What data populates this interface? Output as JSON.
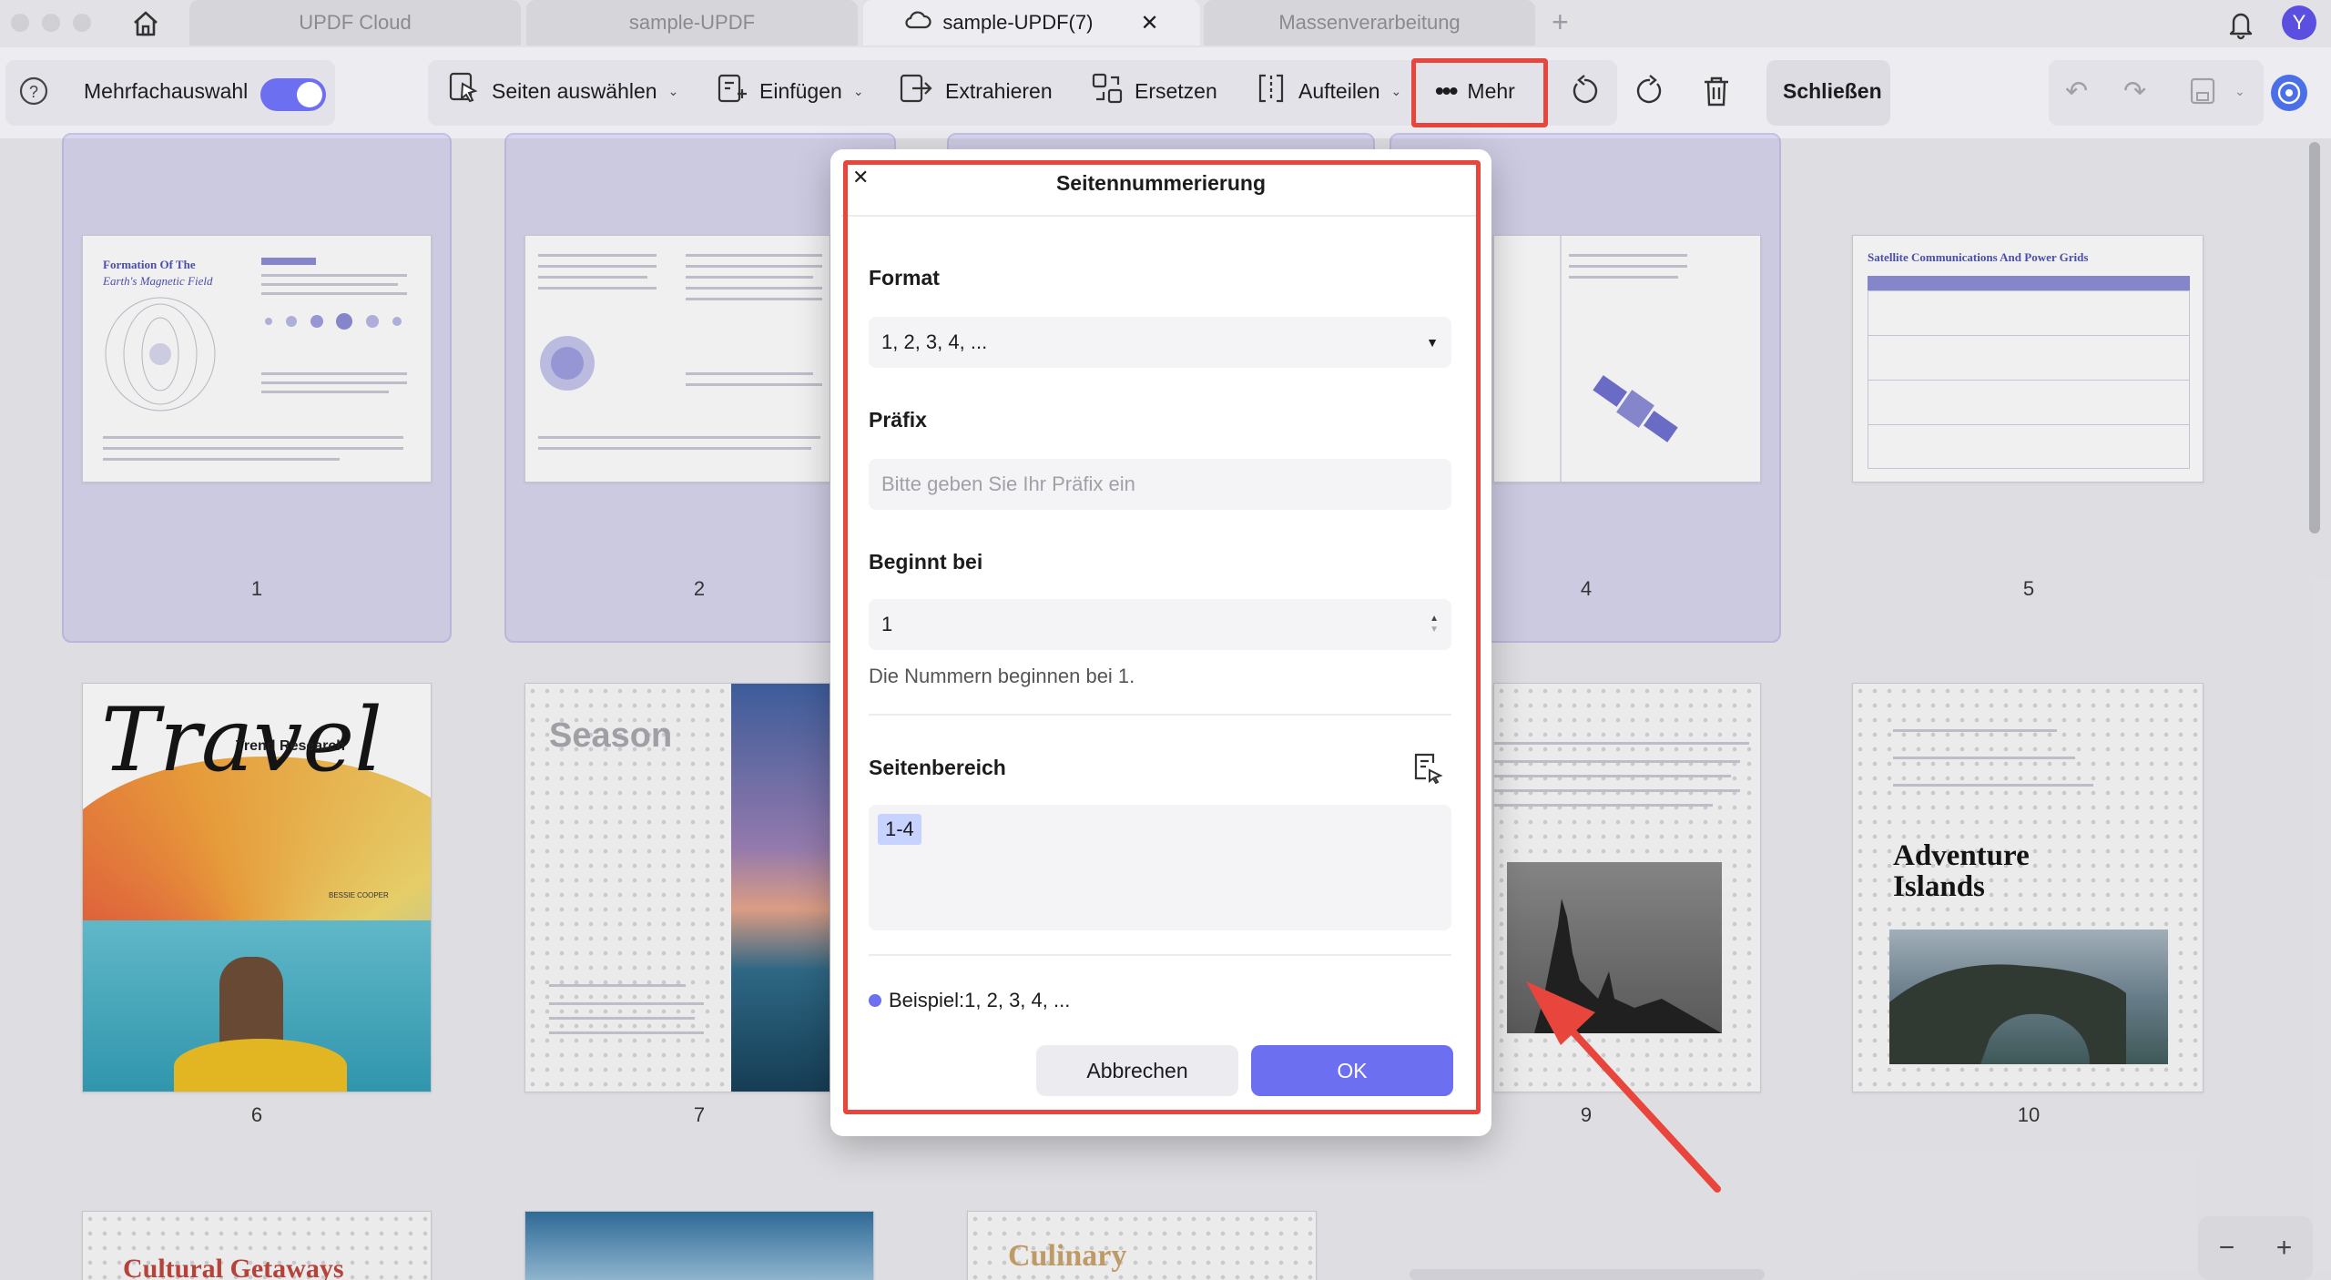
{
  "tabs": [
    {
      "label": "UPDF Cloud"
    },
    {
      "label": "sample-UPDF"
    },
    {
      "label": "sample-UPDF(7)",
      "icon": "cloud-icon"
    },
    {
      "label": "Massenverarbeitung"
    }
  ],
  "user_initial": "Y",
  "toolbar": {
    "multi_select_label": "Mehrfachauswahl",
    "multi_select_on": true,
    "select_pages": "Seiten auswählen",
    "insert": "Einfügen",
    "extract": "Extrahieren",
    "replace": "Ersetzen",
    "split": "Aufteilen",
    "more": "Mehr",
    "close": "Schließen"
  },
  "pages": [
    {
      "num": "1",
      "title": "Formation Of The",
      "subtitle": "Earth's Magnetic Field"
    },
    {
      "num": "2"
    },
    {
      "num": "4"
    },
    {
      "num": "5",
      "title": "Satellite Communications And Power Grids"
    },
    {
      "num": "6",
      "title": "Travel",
      "subtitle": "Trend Research",
      "author": "BESSIE COOPER"
    },
    {
      "num": "7",
      "title": "Season"
    },
    {
      "num": "9"
    },
    {
      "num": "10",
      "title": "Adventure Islands"
    },
    {
      "title": "Cultural Getaways"
    },
    {
      "title": "Culinary"
    }
  ],
  "dialog": {
    "title": "Seitennummerierung",
    "format_label": "Format",
    "format_value": "1, 2, 3, 4, ...",
    "prefix_label": "Präfix",
    "prefix_placeholder": "Bitte geben Sie Ihr Präfix ein",
    "start_label": "Beginnt bei",
    "start_value": "1",
    "start_hint": "Die Nummern beginnen bei 1.",
    "range_label": "Seitenbereich",
    "range_value": "1-4",
    "example": "Beispiel:1, 2, 3, 4, ...",
    "cancel": "Abbrechen",
    "ok": "OK"
  },
  "colors": {
    "accent": "#6b6ff0",
    "highlight": "#e8453c",
    "selected_card": "#d8d6ef"
  }
}
